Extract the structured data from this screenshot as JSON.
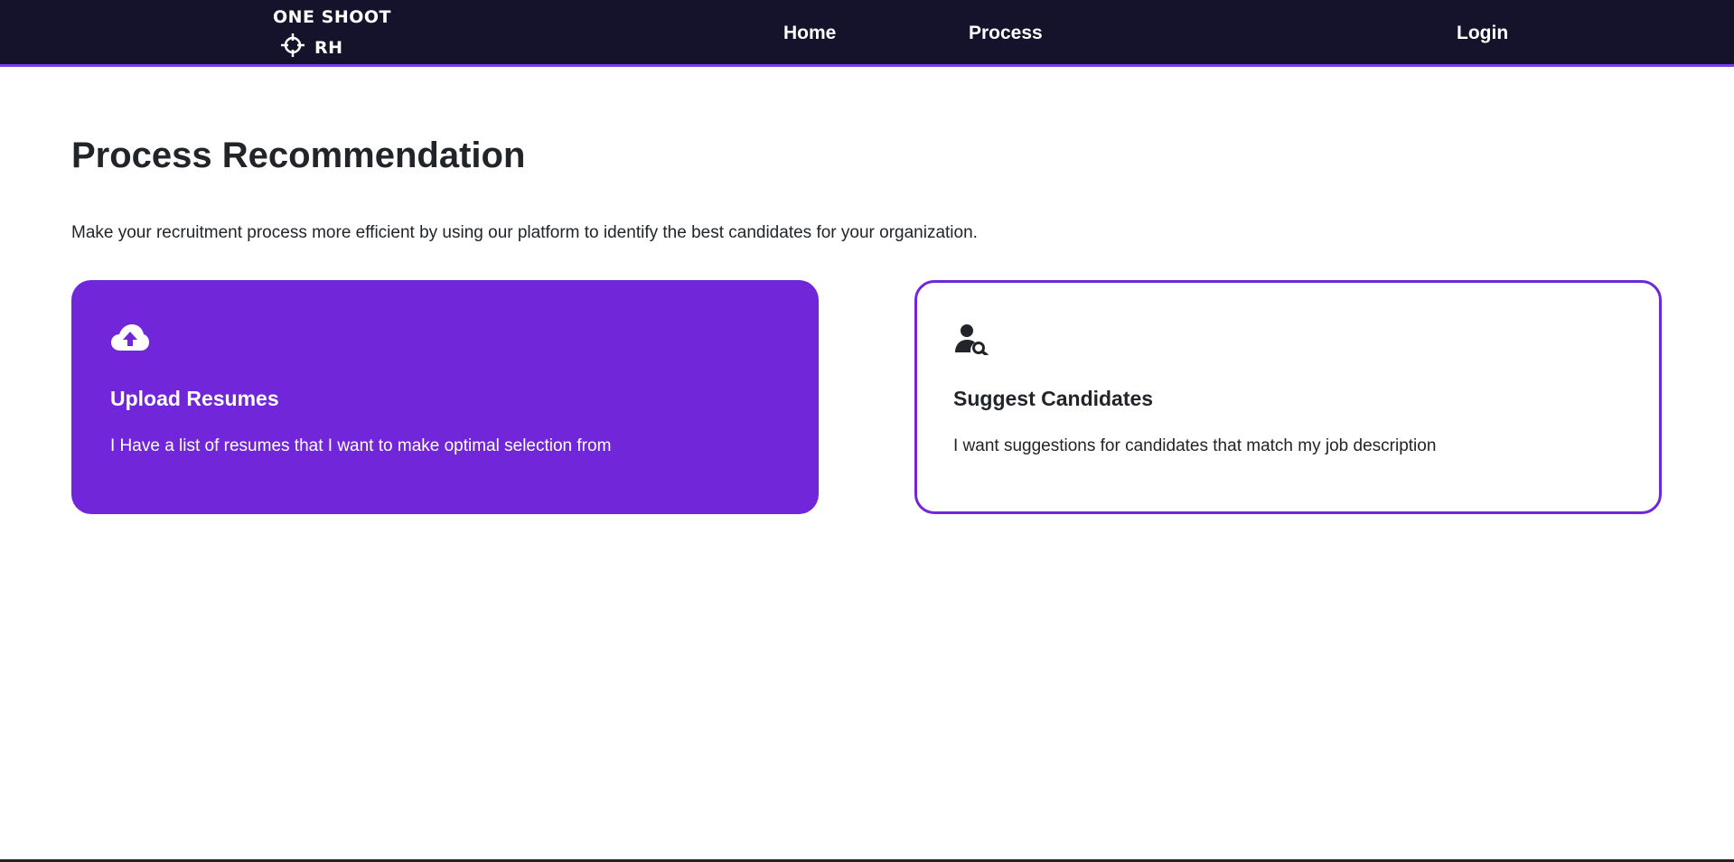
{
  "navbar": {
    "logo": {
      "line1": "ONE SHOOT",
      "line2": "RH",
      "icon": "crosshair-icon"
    },
    "links": {
      "home": "Home",
      "process": "Process",
      "login": "Login"
    },
    "background_color": "#15132b",
    "accent_color": "#7c3aed"
  },
  "main": {
    "title": "Process Recommendation",
    "description": "Make your recruitment process more efficient by using our platform to identify the best candidates for your organization.",
    "cards": [
      {
        "icon": "cloud-upload-icon",
        "title": "Upload Resumes",
        "text": "I Have a list of resumes that I want to make optimal selection from",
        "style": "filled",
        "color": "#7126da"
      },
      {
        "icon": "user-search-icon",
        "title": "Suggest Candidates",
        "text": "I want suggestions for candidates that match my job description",
        "style": "outlined",
        "color": "#7126da"
      }
    ]
  }
}
